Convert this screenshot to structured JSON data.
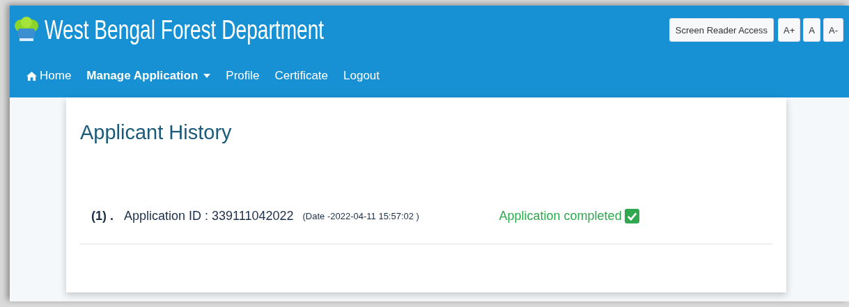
{
  "header": {
    "title": "West Bengal Forest Department",
    "buttons": [
      {
        "label": "Screen Reader Access",
        "kind": "wide"
      },
      {
        "label": "A+",
        "kind": "small"
      },
      {
        "label": "A",
        "kind": "small"
      },
      {
        "label": "A-",
        "kind": "small"
      }
    ]
  },
  "nav": [
    {
      "label": "Home",
      "kind": "home",
      "selected": false
    },
    {
      "label": "Manage Application",
      "kind": "dropdown",
      "selected": true
    },
    {
      "label": "Profile",
      "kind": "link",
      "selected": false
    },
    {
      "label": "Certificate",
      "kind": "link",
      "selected": false
    },
    {
      "label": "Logout",
      "kind": "link",
      "selected": false
    }
  ],
  "page": {
    "heading": "Applicant History",
    "applications": [
      {
        "number": "(1) .",
        "id": "Application ID : 339111042022",
        "date": "(Date -2022-04-11 15:57:02 )",
        "status": "Application completed",
        "completed": true
      }
    ]
  }
}
